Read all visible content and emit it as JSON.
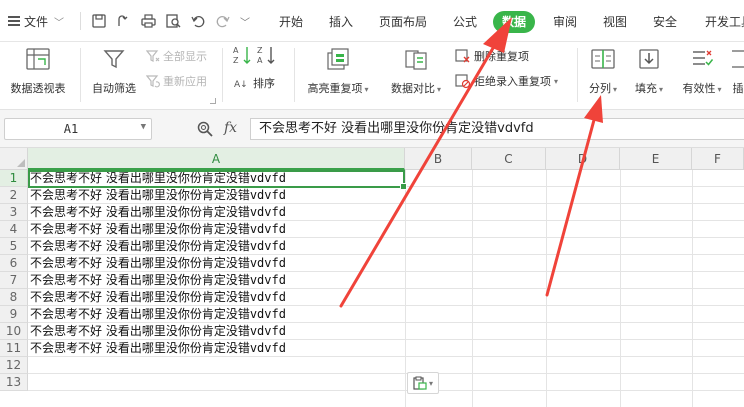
{
  "menubar": {
    "file_label": "文件",
    "tabs": [
      {
        "label": "开始",
        "active": false
      },
      {
        "label": "插入",
        "active": false
      },
      {
        "label": "页面布局",
        "active": false
      },
      {
        "label": "公式",
        "active": false
      },
      {
        "label": "数据",
        "active": true
      },
      {
        "label": "审阅",
        "active": false
      },
      {
        "label": "视图",
        "active": false
      },
      {
        "label": "安全",
        "active": false
      },
      {
        "label": "开发工具",
        "active": false
      }
    ],
    "quick_access": [
      "save-icon",
      "convert-icon",
      "print-icon",
      "print-preview-icon",
      "undo-icon",
      "redo-icon",
      "more-chevron-icon"
    ]
  },
  "ribbon": {
    "pivot_table": "数据透视表",
    "auto_filter": "自动筛选",
    "show_all": "全部显示",
    "reapply": "重新应用",
    "sort": "排序",
    "highlight_duplicates": "高亮重复项",
    "compare": "数据对比",
    "remove_duplicates": "删除重复项",
    "reject_duplicates": "拒绝录入重复项",
    "split_columns": "分列",
    "fill": "填充",
    "validity": "有效性",
    "insert_partial": "插"
  },
  "formula_bar": {
    "cell_ref": "A1",
    "fx_label": "fx",
    "content": "不会思考不好 没看出哪里没你份肯定没错vdvfd"
  },
  "grid": {
    "columns": [
      "A",
      "B",
      "C",
      "D",
      "E",
      "F"
    ],
    "selected_column": "A",
    "rows": [
      {
        "num": "1",
        "text": "不会思考不好 没看出哪里没你份肯定没错",
        "suffix": "vdvfd"
      },
      {
        "num": "2",
        "text": "不会思考不好 没看出哪里没你份肯定没错",
        "suffix": "vdvfd"
      },
      {
        "num": "3",
        "text": "不会思考不好 没看出哪里没你份肯定没错",
        "suffix": "vdvfd"
      },
      {
        "num": "4",
        "text": "不会思考不好 没看出哪里没你份肯定没错",
        "suffix": "vdvfd"
      },
      {
        "num": "5",
        "text": "不会思考不好 没看出哪里没你份肯定没错",
        "suffix": "vdvfd"
      },
      {
        "num": "6",
        "text": "不会思考不好 没看出哪里没你份肯定没错",
        "suffix": "vdvfd"
      },
      {
        "num": "7",
        "text": "不会思考不好 没看出哪里没你份肯定没错",
        "suffix": "vdvfd"
      },
      {
        "num": "8",
        "text": "不会思考不好 没看出哪里没你份肯定没错",
        "suffix": "vdvfd"
      },
      {
        "num": "9",
        "text": "不会思考不好 没看出哪里没你份肯定没错",
        "suffix": "vdvfd"
      },
      {
        "num": "10",
        "text": "不会思考不好 没看出哪里没你份肯定没错",
        "suffix": "vdvfd"
      },
      {
        "num": "11",
        "text": "不会思考不好 没看出哪里没你份肯定没错",
        "suffix": "vdvfd"
      },
      {
        "num": "12",
        "text": "",
        "suffix": ""
      },
      {
        "num": "13",
        "text": "",
        "suffix": ""
      }
    ]
  },
  "colors": {
    "accent": "#39b54a",
    "annotation_arrow": "#f0433a"
  }
}
